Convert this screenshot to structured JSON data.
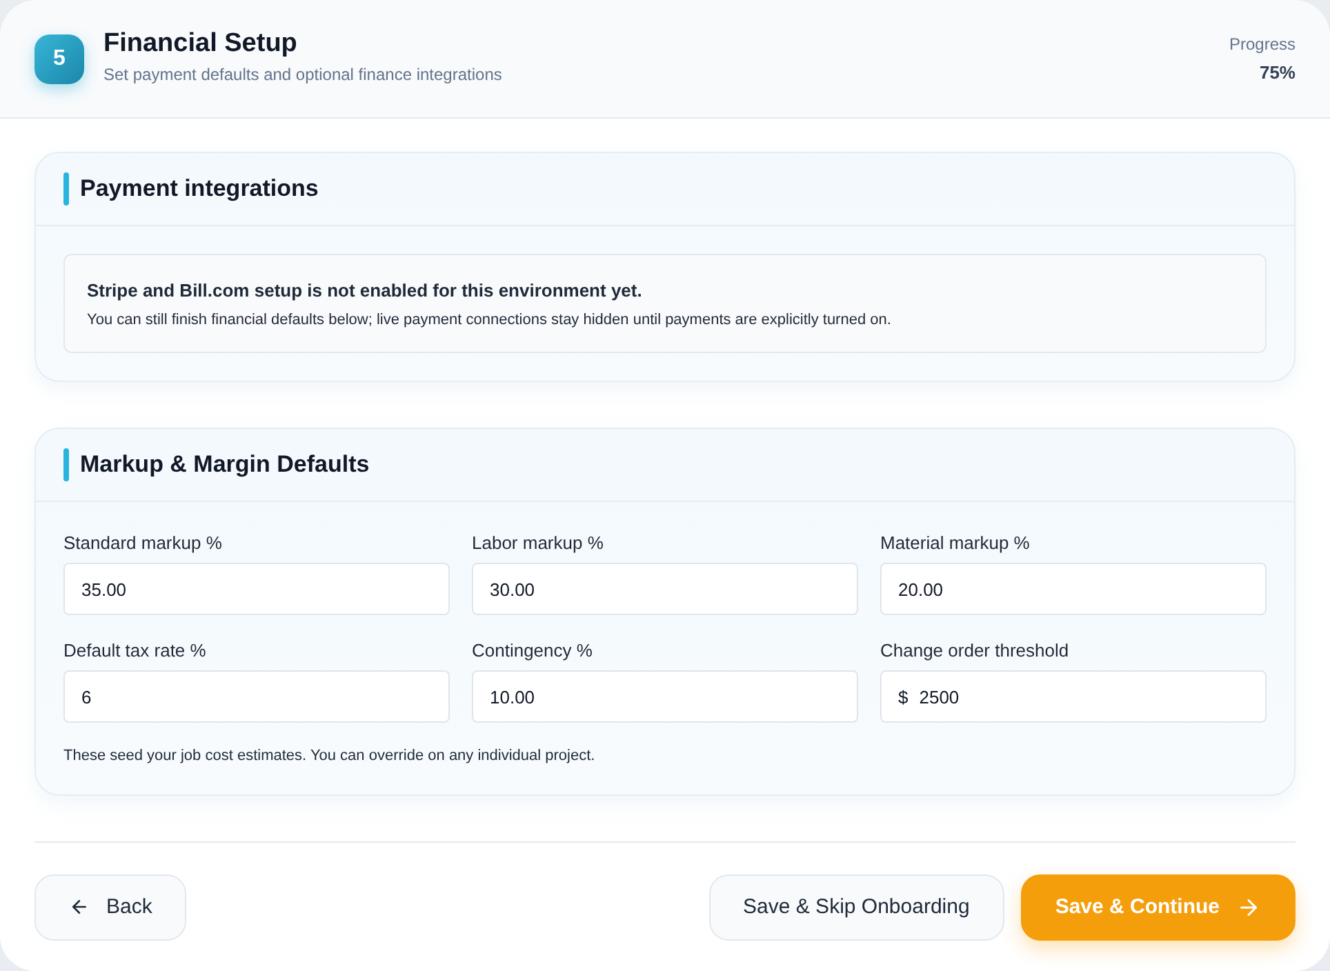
{
  "header": {
    "step": "5",
    "title": "Financial Setup",
    "subtitle": "Set payment defaults and optional finance integrations",
    "progress_label": "Progress",
    "progress_value": "75%"
  },
  "payment_section": {
    "title": "Payment integrations",
    "notice_title": "Stripe and Bill.com setup is not enabled for this environment yet.",
    "notice_body": "You can still finish financial defaults below; live payment connections stay hidden until payments are explicitly turned on."
  },
  "markup_section": {
    "title": "Markup & Margin Defaults",
    "fields": [
      {
        "label": "Standard markup %",
        "value": "35.00"
      },
      {
        "label": "Labor markup %",
        "value": "30.00"
      },
      {
        "label": "Material markup %",
        "value": "20.00"
      },
      {
        "label": "Default tax rate %",
        "value": "6"
      },
      {
        "label": "Contingency %",
        "value": "10.00"
      },
      {
        "label": "Change order threshold",
        "prefix": "$",
        "value": "2500"
      }
    ],
    "hint": "These seed your job cost estimates. You can override on any individual project."
  },
  "footer": {
    "back": "Back",
    "skip": "Save & Skip Onboarding",
    "continue": "Save & Continue"
  }
}
